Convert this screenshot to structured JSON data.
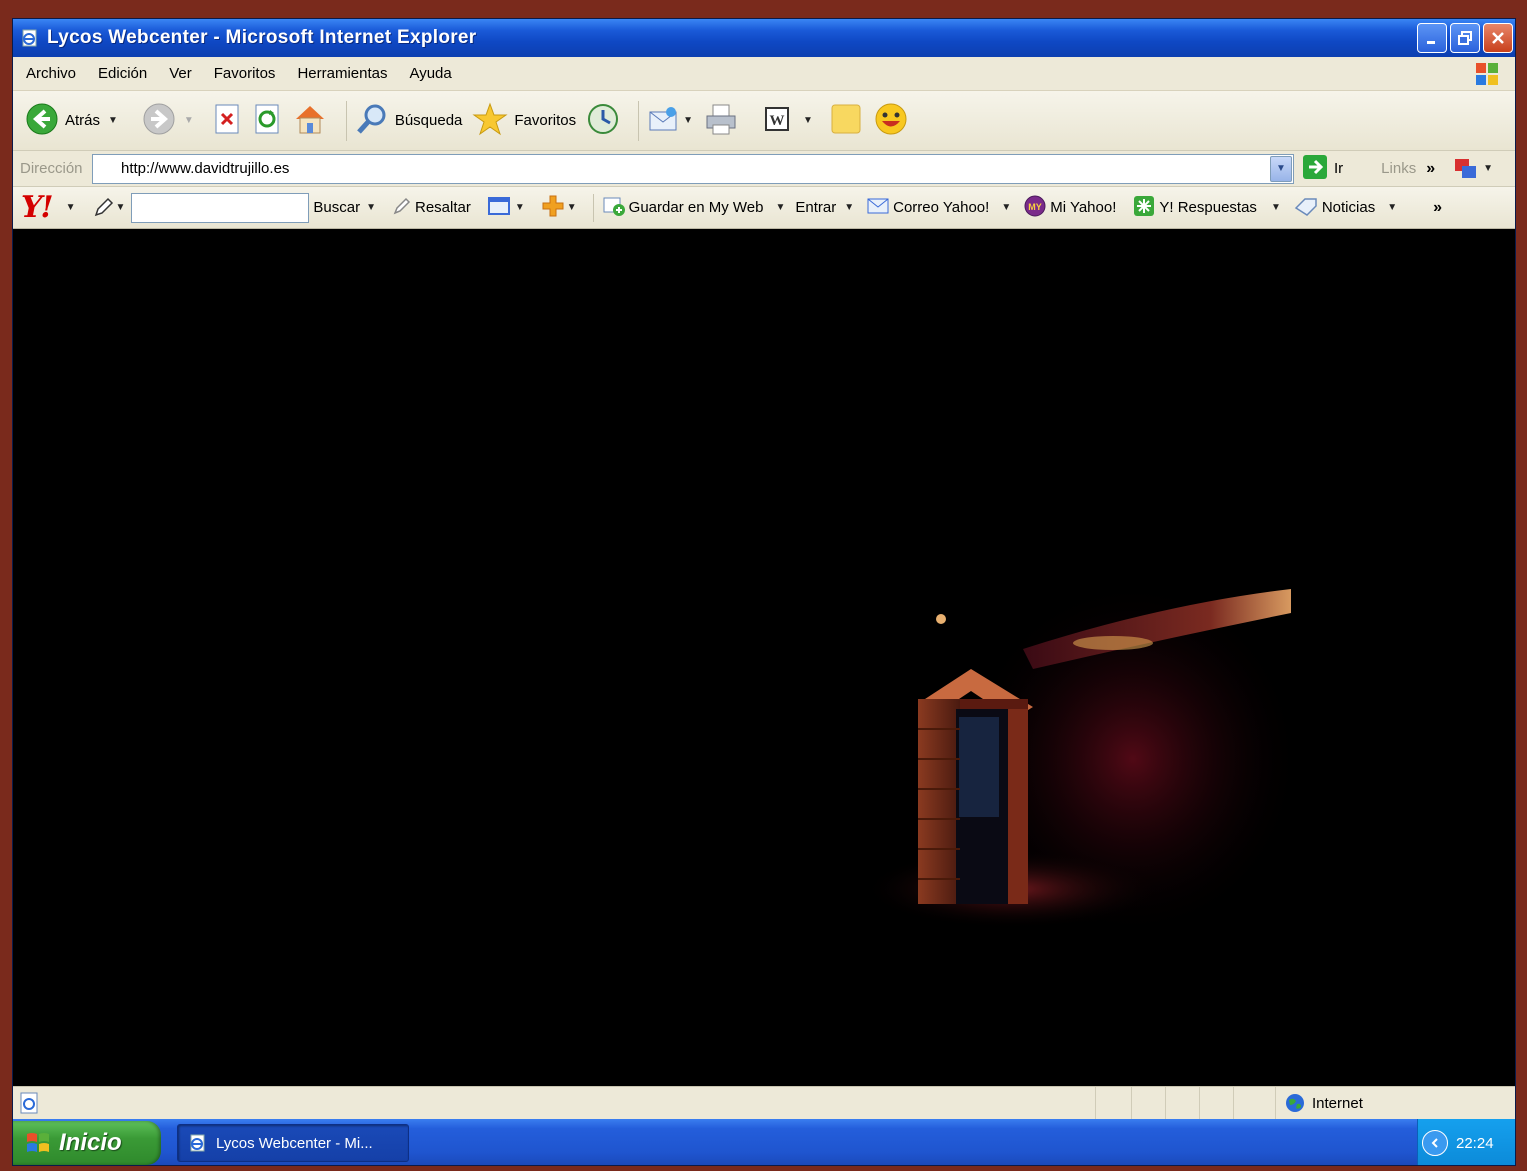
{
  "window": {
    "title": "Lycos Webcenter - Microsoft Internet Explorer"
  },
  "menu": {
    "items": [
      "Archivo",
      "Edición",
      "Ver",
      "Favoritos",
      "Herramientas",
      "Ayuda"
    ]
  },
  "toolbar": {
    "back_label": "Atrás",
    "search_label": "Búsqueda",
    "favorites_label": "Favoritos"
  },
  "address": {
    "label": "Dirección",
    "url": "http://www.davidtrujillo.es",
    "go_label": "Ir",
    "links_label": "Links"
  },
  "yahoo_toolbar": {
    "logo": "Y!",
    "search_value": "",
    "buscar_label": "Buscar",
    "resaltar_label": "Resaltar",
    "guardar_label": "Guardar en My Web",
    "entrar_label": "Entrar",
    "correo_label": "Correo Yahoo!",
    "mi_yahoo_label": "Mi Yahoo!",
    "respuestas_label": "Y! Respuestas",
    "noticias_label": "Noticias"
  },
  "status": {
    "zone_label": "Internet"
  },
  "taskbar": {
    "start_label": "Inicio",
    "task_label": "Lycos Webcenter - Mi...",
    "clock": "22:24"
  }
}
